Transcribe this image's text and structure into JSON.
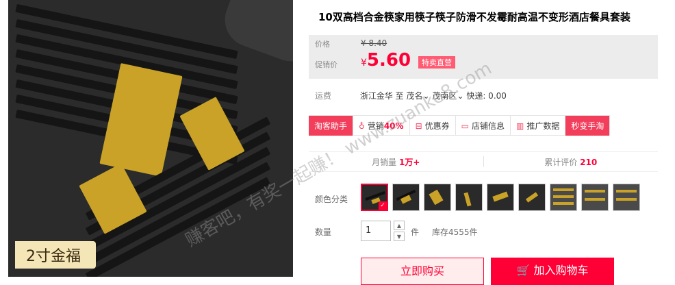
{
  "product": {
    "image_caption": "2寸金福",
    "title": "10双高档合金筷家用筷子筷子防滑不发霉耐高温不变形酒店餐具套装"
  },
  "price": {
    "label": "价格",
    "original": "¥ 8.40",
    "promo_label": "促销价",
    "currency": "¥",
    "promo": "5.60",
    "badge": "特卖直营"
  },
  "shipping": {
    "label": "运费",
    "from": "浙江金华",
    "to_word": "至",
    "city": "茂名",
    "district": "茂南区",
    "express": "快递: 0.00"
  },
  "tools": [
    {
      "label": "淘客助手",
      "style": "red"
    },
    {
      "label": "营销",
      "value": "40%",
      "icon": "sale-icon"
    },
    {
      "label": "优惠券",
      "icon": "coupon-icon"
    },
    {
      "label": "店铺信息",
      "icon": "shop-icon"
    },
    {
      "label": "推广数据",
      "icon": "chart-icon"
    },
    {
      "label": "秒变手淘",
      "style": "red"
    }
  ],
  "stats": {
    "monthly_sales_label": "月销量",
    "monthly_sales_value": "1万+",
    "reviews_label": "累计评价",
    "reviews_value": "210"
  },
  "color": {
    "label": "颜色分类",
    "count": 9,
    "selected_index": 0
  },
  "quantity": {
    "label": "数量",
    "value": "1",
    "unit": "件",
    "stock": "库存4555件"
  },
  "actions": {
    "buy": "立即购买",
    "cart": "加入购物车"
  },
  "watermark": "赚客吧，有奖一起赚！ www.zuanke8.com",
  "colors": {
    "accent": "#ff0036",
    "tool_red": "#f23d5b",
    "badge_pink": "#ff5b73",
    "price_bg": "#ececec"
  }
}
